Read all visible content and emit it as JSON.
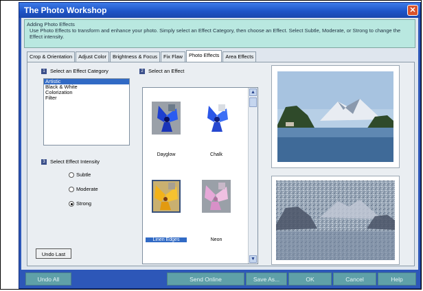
{
  "window": {
    "title": "The Photo Workshop"
  },
  "info": {
    "heading": "Adding Photo Effects",
    "text": "Use Photo Effects to transform and enhance your photo.  Simply select an Effect Category, then choose an Effect.  Select Subtle, Moderate, or Strong to change the Effect intensity."
  },
  "tabs": [
    "Crop & Orientation",
    "Adjust Color",
    "Brightness & Focus",
    "Fix Flaw",
    "Photo Effects",
    "Area Effects"
  ],
  "active_tab": "Photo Effects",
  "category": {
    "step": "1",
    "label": "Select an Effect Category",
    "items": [
      "Artistic",
      "Black & White",
      "Colorization",
      "Filter"
    ],
    "selected": "Artistic"
  },
  "intensity": {
    "step": "3",
    "label": "Select Effect Intensity",
    "options": [
      "Subtle",
      "Moderate",
      "Strong"
    ],
    "selected": "Strong"
  },
  "effects": {
    "step": "2",
    "label": "Select an Effect",
    "items": [
      "Dayglow",
      "Chalk",
      "Linen Edges",
      "Neon"
    ],
    "selected": "Linen Edges"
  },
  "buttons": {
    "undo_last": "Undo Last",
    "undo_all": "Undo All",
    "send_online": "Send Online",
    "save_as": "Save As...",
    "ok": "OK",
    "cancel": "Cancel",
    "help": "Help"
  },
  "colors": {
    "title_bar": "#1f55c8",
    "bottom_buttons": "#5fa0a8",
    "selection": "#316ac5",
    "info_box": "#b9e8e0"
  }
}
